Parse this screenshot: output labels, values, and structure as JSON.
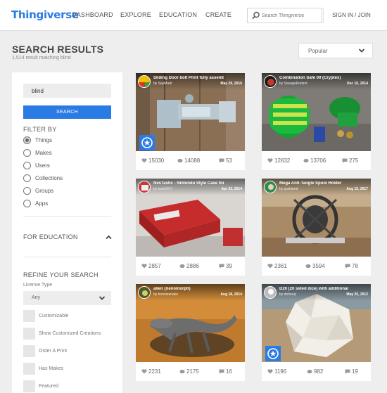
{
  "nav": {
    "logo": "Thingiverse",
    "links": [
      "DASHBOARD",
      "EXPLORE",
      "EDUCATION",
      "CREATE"
    ],
    "search_placeholder": "Search Thingiverse",
    "signin": "SIGN IN / JOIN",
    "brand_color": "#2b7be4"
  },
  "header": {
    "title": "SEARCH RESULTS",
    "count": "1,514 result matching blind",
    "sort": "Popular"
  },
  "sidebar": {
    "query": "blind",
    "search_button": "SEARCH",
    "filter_heading": "FILTER BY",
    "filters": [
      "Things",
      "Makes",
      "Users",
      "Collections",
      "Groups",
      "Apps"
    ],
    "selected_filter": "Things",
    "education_heading": "FOR EDUCATION",
    "refine_heading": "REFINE YOUR SEARCH",
    "license_label": "License Type",
    "license_value": "Any",
    "checkboxes": [
      "Customizable",
      "Show Customized Creations",
      "Order A Print",
      "Has Makes",
      "Featured"
    ]
  },
  "cards": [
    {
      "title": "Sliding Door bolt Print fully assembled",
      "by": "by SayMarti",
      "date": "May 29, 2016",
      "likes": "15030",
      "collects": "14088",
      "comments": "53",
      "badge": true,
      "icons": {
        "like": "heart-icon",
        "collect": "collect-icon",
        "comment": "comment-icon"
      }
    },
    {
      "title": "Combination Safe 00 (Cryptex)",
      "by": "by SavageRodent",
      "date": "Dec 10, 2014",
      "likes": "12832",
      "collects": "13706",
      "comments": "275",
      "badge": false
    },
    {
      "title": "NesTastic - Nintendo Style Case for the R...",
      "by": "by tastic007",
      "date": "Apr 23, 2014",
      "likes": "2857",
      "collects": "2886",
      "comments": "39",
      "badge": false
    },
    {
      "title": "Mega Anti-Tangle Spool Holder",
      "by": "by grahamd",
      "date": "Aug 15, 2017",
      "likes": "2361",
      "collects": "3594",
      "comments": "78",
      "badge": false
    },
    {
      "title": "alien (Xenomorph)",
      "by": "by bonniesnake",
      "date": "Aug 18, 2014",
      "likes": "2231",
      "collects": "2175",
      "comments": "16",
      "badge": false
    },
    {
      "title": "D20 (20 sided dice) with additional braill...",
      "by": "by dehouq",
      "date": "May 25, 2012",
      "likes": "1196",
      "collects": "982",
      "comments": "19",
      "badge": true
    }
  ]
}
